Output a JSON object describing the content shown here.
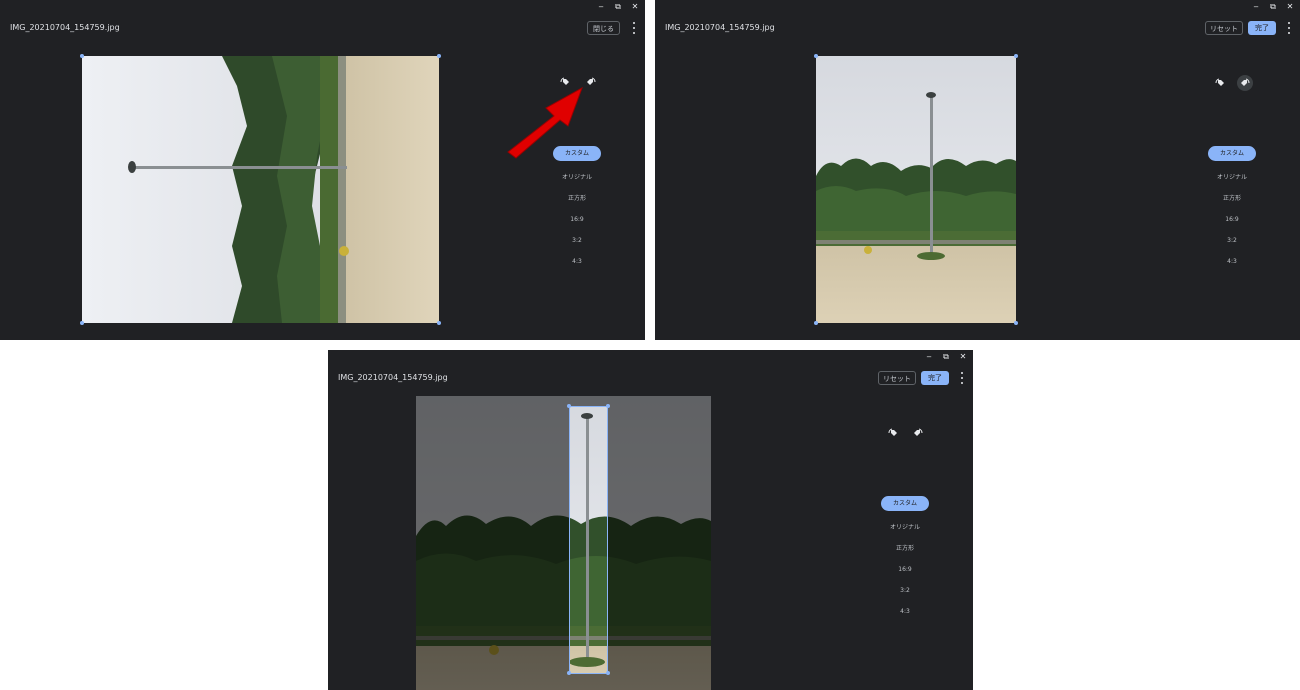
{
  "filename": "IMG_20210704_154759.jpg",
  "window_controls": {
    "minimize": "‒",
    "restore": "⧉",
    "close": "✕"
  },
  "panel1": {
    "close_label": "閉じる"
  },
  "panel2": {
    "reset_label": "リセット",
    "done_label": "完了"
  },
  "panel3": {
    "reset_label": "リセット",
    "done_label": "完了"
  },
  "aspect_ratios": [
    {
      "label": "カスタム",
      "selected": true
    },
    {
      "label": "オリジナル",
      "selected": false
    },
    {
      "label": "正方形",
      "selected": false
    },
    {
      "label": "16:9",
      "selected": false
    },
    {
      "label": "3:2",
      "selected": false
    },
    {
      "label": "4:3",
      "selected": false
    }
  ],
  "icons": {
    "rotate_left": "rotate-left-icon",
    "rotate_right": "rotate-right-icon",
    "more": "more-vert-icon"
  },
  "colors": {
    "accent": "#8ab4f8",
    "background": "#202124",
    "arrow": "#e00000"
  }
}
